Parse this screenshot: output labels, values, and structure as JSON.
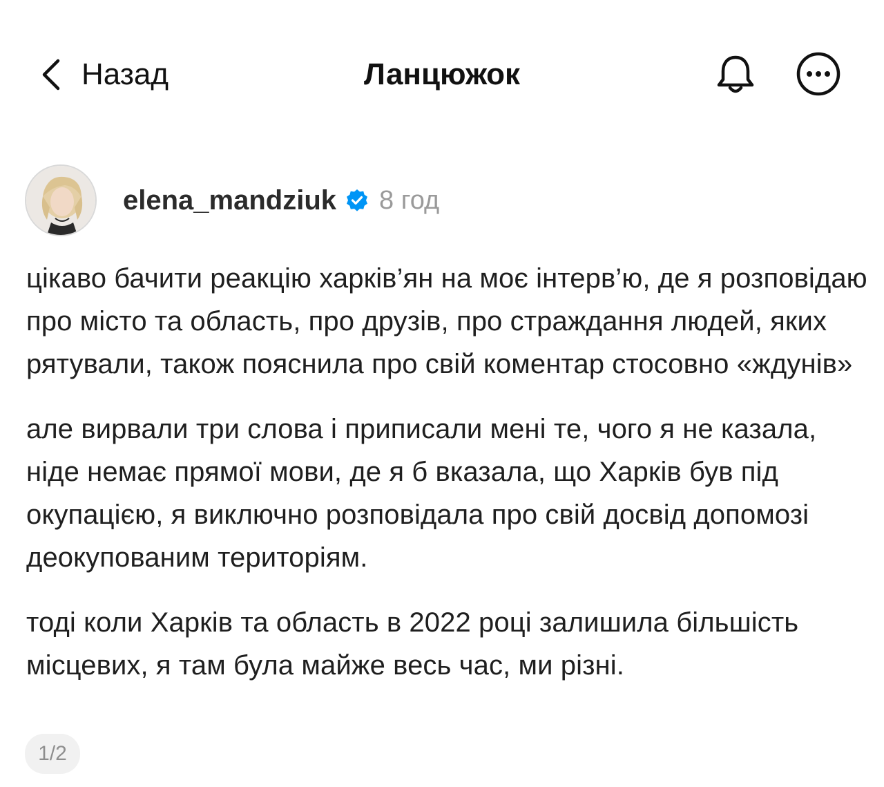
{
  "nav": {
    "back_label": "Назад",
    "title": "Ланцюжок",
    "icons": [
      "chevron-left-icon",
      "bell-icon",
      "more-icon"
    ]
  },
  "post": {
    "username": "elena_mandziuk",
    "verified": true,
    "time": "8 год",
    "paragraphs": [
      "цікаво бачити реакцію харків’ян на моє інтерв’ю, де я розповідаю про місто та область, про друзів, про страждання людей, яких рятували, також пояснила про свій коментар стосовно «ждунів»",
      "але вирвали три слова і приписали мені те, чого я не казала, ніде немає прямої мови, де я б вказала, що Харків був під окупацією, я виключно розповідала про свій досвід допомозі деокупованим територіям.",
      "тоді коли Харків та область в 2022 році залишила більшість місцевих, я там була майже весь час, ми різні."
    ],
    "pager": "1/2"
  },
  "colors": {
    "verified_badge": "#0095f6",
    "muted_text": "#9a9a9a",
    "pager_bg": "#f1f1f1"
  }
}
